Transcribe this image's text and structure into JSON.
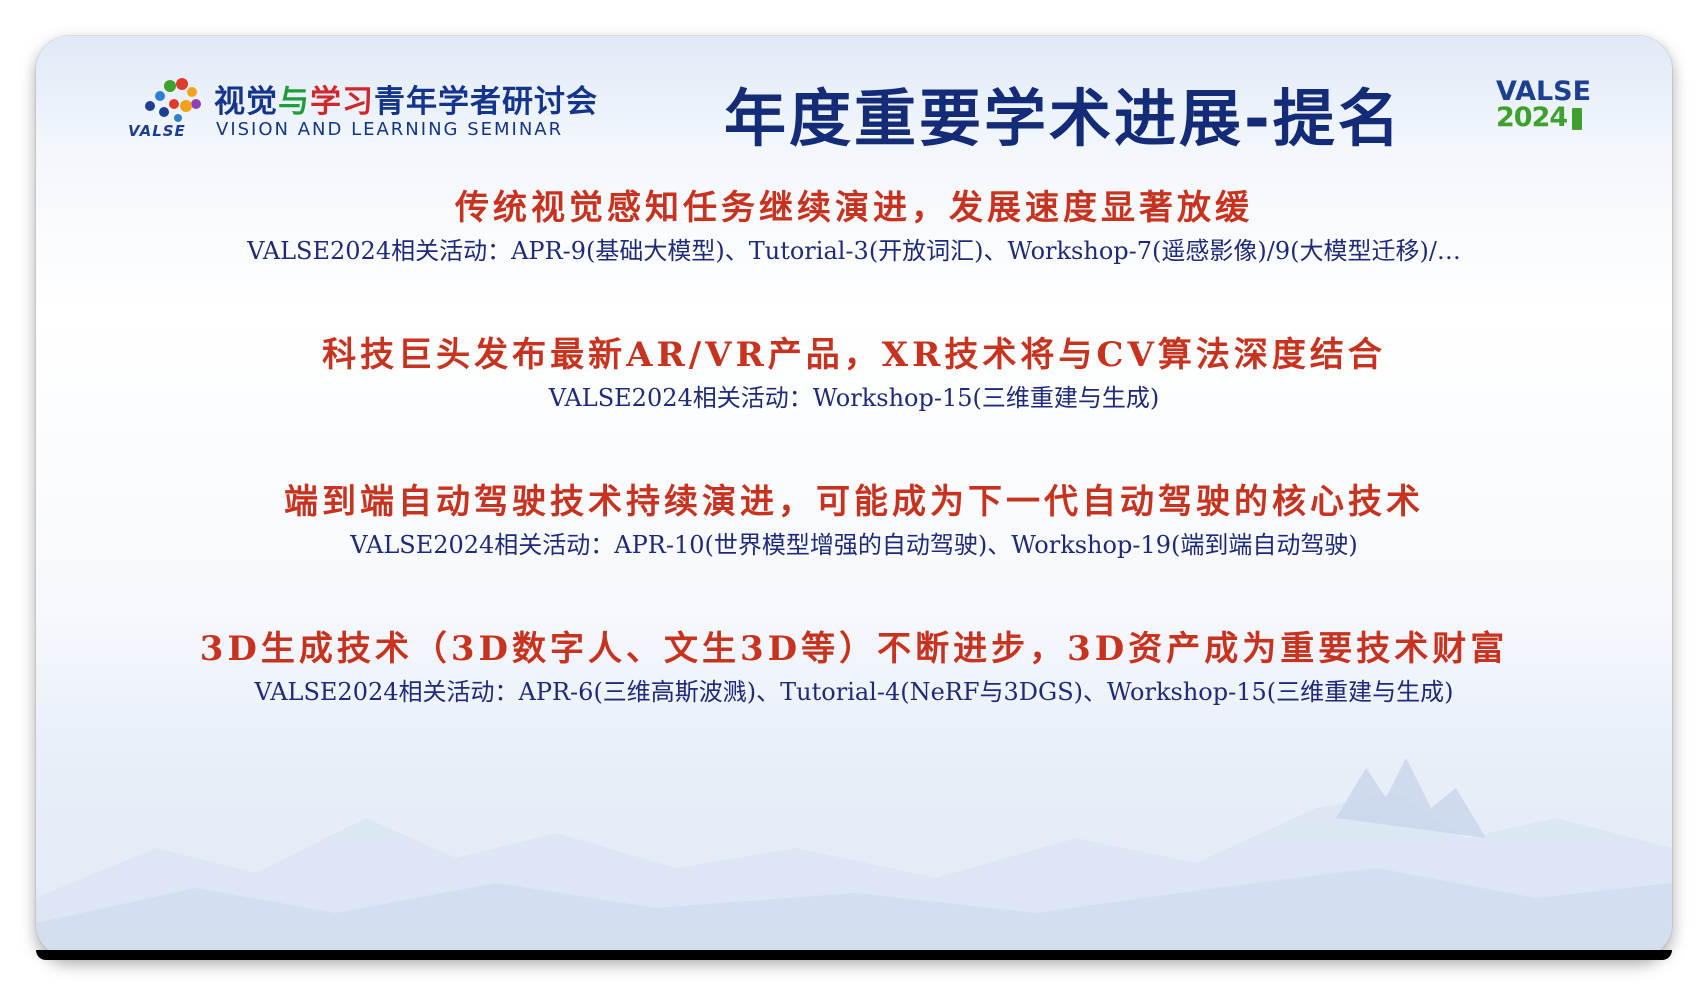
{
  "header": {
    "logo_text": "VALSE",
    "seminar_cn_part1": "视觉",
    "seminar_cn_part2": "与",
    "seminar_cn_part3": "学习",
    "seminar_cn_part4": "青年学者研讨会",
    "seminar_en": "VISION AND LEARNING SEMINAR",
    "title": "年度重要学术进展-提名",
    "badge_top": "VALSE",
    "badge_year": "2024"
  },
  "items": [
    {
      "headline": "传统视觉感知任务继续演进，发展速度显著放缓",
      "activity": "VALSE2024相关活动：APR-9(基础大模型)、Tutorial-3(开放词汇)、Workshop-7(遥感影像)/9(大模型迁移)/…"
    },
    {
      "headline": "科技巨头发布最新AR/VR产品，XR技术将与CV算法深度结合",
      "activity": "VALSE2024相关活动：Workshop-15(三维重建与生成)"
    },
    {
      "headline": "端到端自动驾驶技术持续演进，可能成为下一代自动驾驶的核心技术",
      "activity": "VALSE2024相关活动：APR-10(世界模型增强的自动驾驶)、Workshop-19(端到端自动驾驶)"
    },
    {
      "headline": "3D生成技术（3D数字人、文生3D等）不断进步，3D资产成为重要技术财富",
      "activity": "VALSE2024相关活动：APR-6(三维高斯波溅)、Tutorial-4(NeRF与3DGS)、Workshop-15(三维重建与生成)"
    }
  ],
  "colors": {
    "headline": "#c8331f",
    "activity": "#1f2a78",
    "title": "#142b78",
    "brand_green": "#3ea12e",
    "brand_blue": "#1d3f8f"
  }
}
